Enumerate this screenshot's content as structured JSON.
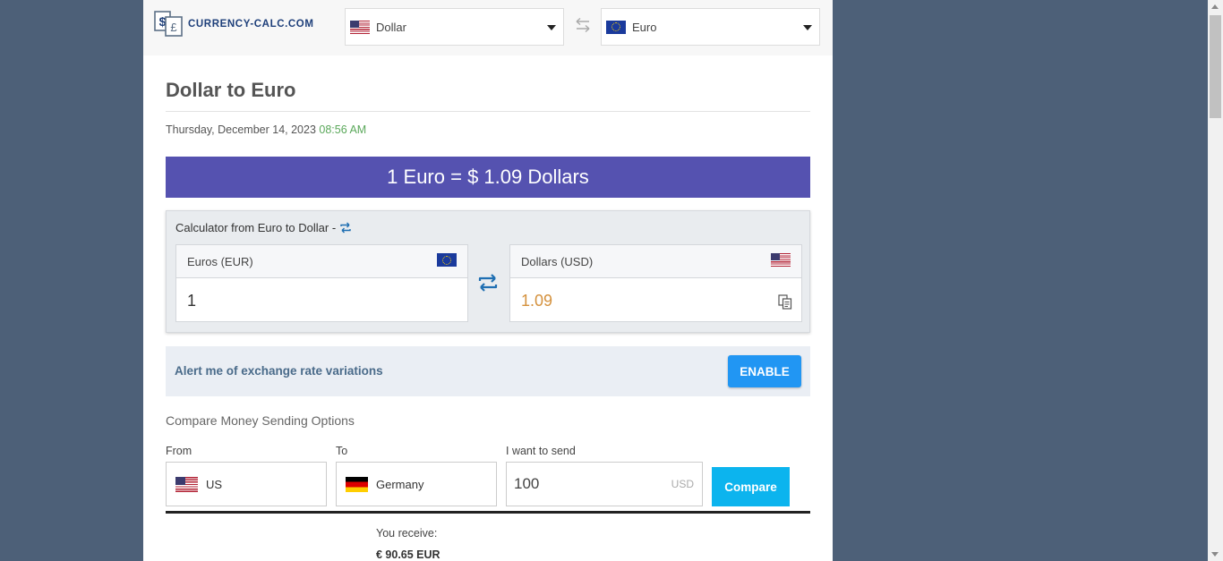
{
  "header": {
    "logo_text": "CURRENCY-CALC.COM",
    "from_currency": "Dollar",
    "to_currency": "Euro"
  },
  "page": {
    "title": "Dollar to Euro",
    "date": "Thursday, December 14, 2023",
    "time": "08:56 AM",
    "rate_banner": "1 Euro = $ 1.09 Dollars"
  },
  "calculator": {
    "title": "Calculator from Euro to Dollar -",
    "from_label": "Euros (EUR)",
    "from_value": "1",
    "to_label": "Dollars (USD)",
    "to_value": "1.09"
  },
  "alert": {
    "text": "Alert me of exchange rate variations",
    "button_label": "ENABLE"
  },
  "compare": {
    "title": "Compare Money Sending Options",
    "from_label": "From",
    "from_value": "US",
    "to_label": "To",
    "to_value": "Germany",
    "send_label": "I want to send",
    "send_amount": "100",
    "send_unit": "USD",
    "button_label": "Compare",
    "receive_label": "You receive:",
    "receive_value": "€ 90.65 EUR"
  },
  "colors": {
    "banner": "#5552b0",
    "enable_button": "#2196f3",
    "compare_button": "#0cb4ee",
    "time_text": "#5aa85a",
    "result_value": "#d4913d",
    "background": "#4d6078"
  },
  "icons": [
    "currency-logo-icon",
    "flag-us-icon",
    "flag-eu-icon",
    "flag-de-icon",
    "swap-arrows-icon",
    "cycle-icon",
    "copy-icon",
    "caret-down-icon"
  ]
}
